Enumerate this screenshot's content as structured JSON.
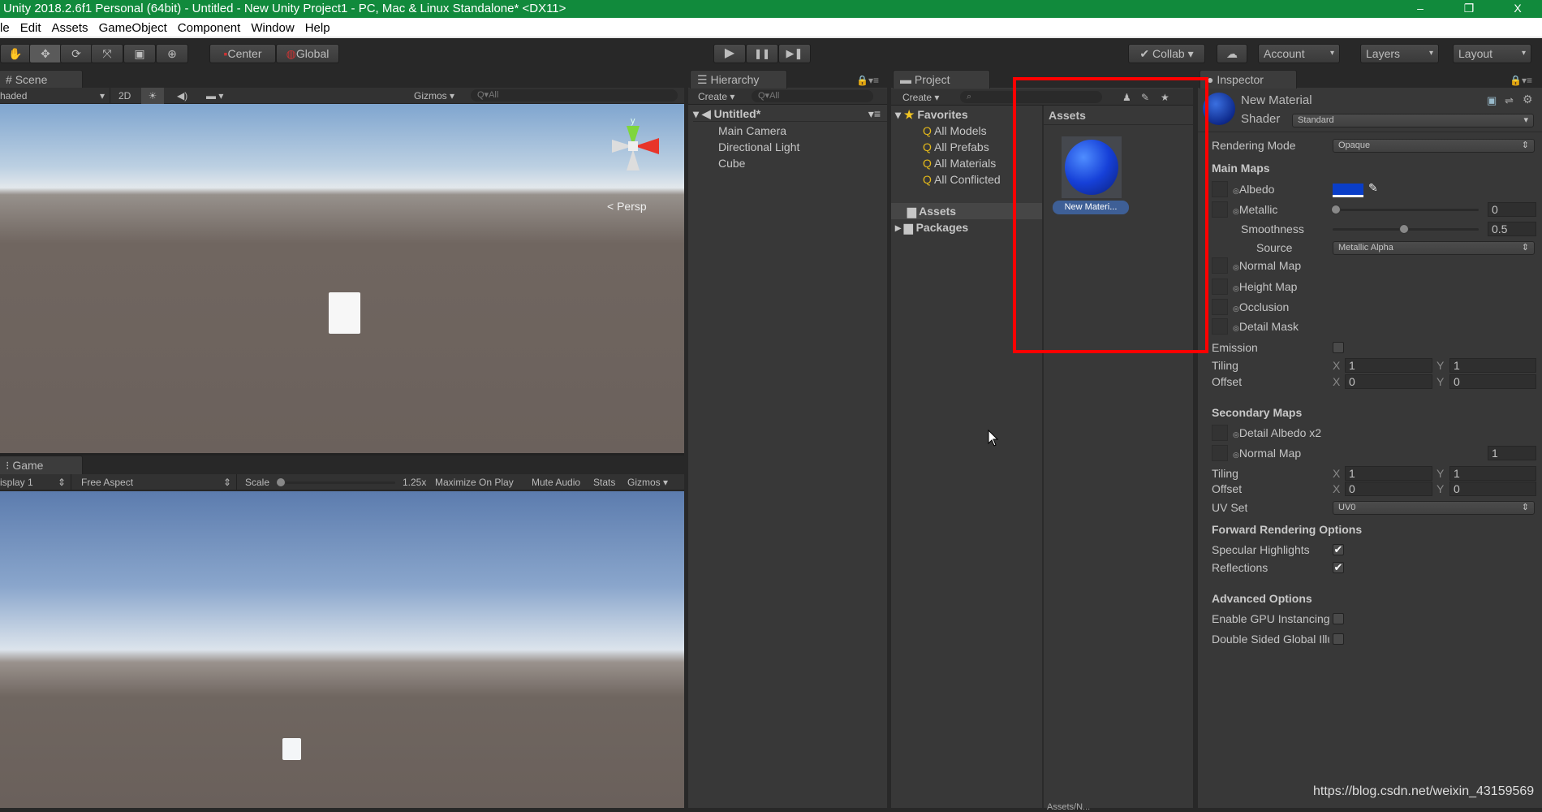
{
  "window": {
    "title": "Unity 2018.2.6f1 Personal (64bit) - Untitled - New Unity Project1 - PC, Mac & Linux Standalone* <DX11>",
    "minimize": "–",
    "restore": "❐",
    "close": "X"
  },
  "menu": [
    "le",
    "Edit",
    "Assets",
    "GameObject",
    "Component",
    "Window",
    "Help"
  ],
  "toolbar": {
    "tools": [
      "hand-icon",
      "move-icon",
      "rotate-icon",
      "scale-icon",
      "rect-icon",
      "transform-icon"
    ],
    "center": "Center",
    "global": "Global",
    "play": "▶",
    "pause": "❚❚",
    "step": "▶❚",
    "collab": "Collab",
    "cloud": "☁",
    "account": "Account",
    "layers": "Layers",
    "layout": "Layout"
  },
  "scene": {
    "tab": "Scene",
    "shading": "haded",
    "two_d": "2D",
    "gizmos": "Gizmos",
    "search": "All",
    "axis_y": "y",
    "persp": "< Persp"
  },
  "game": {
    "tab": "Game",
    "display": "isplay 1",
    "aspect": "Free Aspect",
    "scale_label": "Scale",
    "scale_value": "1.25x",
    "scale_fraction": 0.0,
    "maximize": "Maximize On Play",
    "mute": "Mute Audio",
    "stats": "Stats",
    "gizmos": "Gizmos"
  },
  "hierarchy": {
    "tab": "Hierarchy",
    "create": "Create",
    "search": "All",
    "scene": "Untitled*",
    "items": [
      "Main Camera",
      "Directional Light",
      "Cube"
    ]
  },
  "project": {
    "tab": "Project",
    "create": "Create",
    "favorites": "Favorites",
    "favorite_items": [
      "All Models",
      "All Prefabs",
      "All Materials",
      "All Conflicted"
    ],
    "folders": [
      "Assets",
      "Packages"
    ],
    "assets_header": "Assets",
    "asset_label": "New Materi...",
    "footer": "Assets/N..."
  },
  "inspector": {
    "tab": "Inspector",
    "name": "New Material",
    "shader_label": "Shader",
    "shader": "Standard",
    "albedo_color": "#0a3ec8",
    "rows": [
      {
        "t": "drop",
        "label": "Rendering Mode",
        "value": "Opaque"
      },
      {
        "t": "head",
        "label": "Main Maps"
      },
      {
        "t": "color",
        "label": "Albedo"
      },
      {
        "t": "slider",
        "label": "Metallic",
        "value": "0",
        "frac": 0,
        "slot": true
      },
      {
        "t": "slider",
        "label": "Smoothness",
        "value": "0.5",
        "frac": 0.5,
        "indent": 1
      },
      {
        "t": "drop",
        "label": "Source",
        "value": "Metallic Alpha",
        "indent": 2
      },
      {
        "t": "tex",
        "label": "Normal Map"
      },
      {
        "t": "tex",
        "label": "Height Map"
      },
      {
        "t": "tex",
        "label": "Occlusion"
      },
      {
        "t": "tex",
        "label": "Detail Mask"
      },
      {
        "t": "check",
        "label": "Emission",
        "checked": false
      },
      {
        "t": "xy",
        "label": "Tiling",
        "x": "1",
        "y": "1"
      },
      {
        "t": "xy",
        "label": "Offset",
        "x": "0",
        "y": "0"
      },
      {
        "t": "head",
        "label": "Secondary Maps"
      },
      {
        "t": "tex",
        "label": "Detail Albedo x2"
      },
      {
        "t": "texval",
        "label": "Normal Map",
        "value": "1"
      },
      {
        "t": "xy",
        "label": "Tiling",
        "x": "1",
        "y": "1"
      },
      {
        "t": "xy",
        "label": "Offset",
        "x": "0",
        "y": "0"
      },
      {
        "t": "drop",
        "label": "UV Set",
        "value": "UV0"
      },
      {
        "t": "head",
        "label": "Forward Rendering Options"
      },
      {
        "t": "check",
        "label": "Specular Highlights",
        "checked": true
      },
      {
        "t": "check",
        "label": "Reflections",
        "checked": true
      },
      {
        "t": "head",
        "label": "Advanced Options"
      },
      {
        "t": "check",
        "label": "Enable GPU Instancing",
        "checked": false
      },
      {
        "t": "check",
        "label": "Double Sided Global Illumination",
        "checked": false
      }
    ]
  },
  "watermark": "https://blog.csdn.net/weixin_43159569",
  "highlight_color": "#ff0000"
}
